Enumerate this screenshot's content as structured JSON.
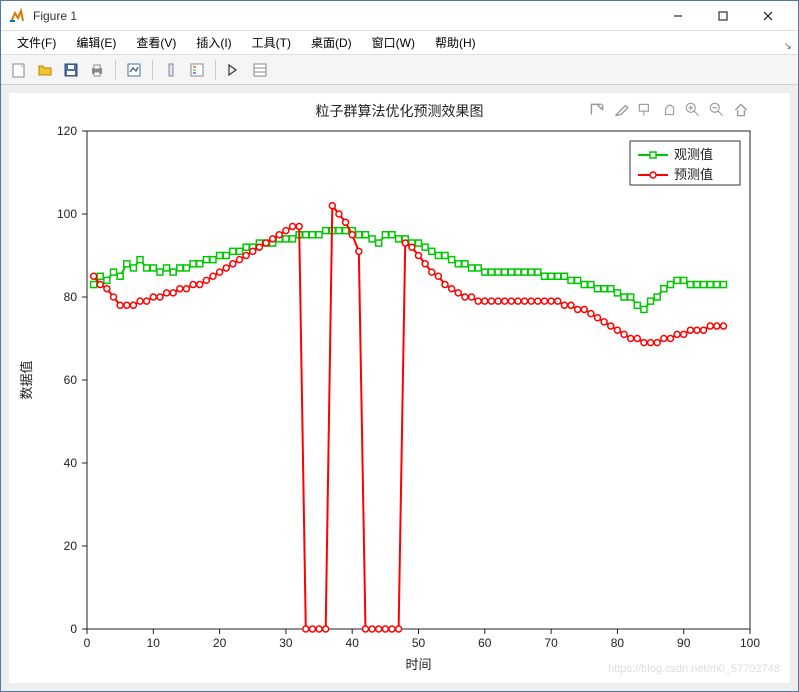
{
  "window": {
    "title": "Figure 1"
  },
  "menu": {
    "file": "文件(F)",
    "edit": "编辑(E)",
    "view": "查看(V)",
    "insert": "插入(I)",
    "tools": "工具(T)",
    "desktop": "桌面(D)",
    "window": "窗口(W)",
    "help": "帮助(H)"
  },
  "chart_data": {
    "type": "line",
    "title": "粒子群算法优化预测效果图",
    "xlabel": "时间",
    "ylabel": "数据值",
    "xlim": [
      0,
      100
    ],
    "ylim": [
      0,
      120
    ],
    "xticks": [
      0,
      10,
      20,
      30,
      40,
      50,
      60,
      70,
      80,
      90,
      100
    ],
    "yticks": [
      0,
      20,
      40,
      60,
      80,
      100,
      120
    ],
    "series": [
      {
        "name": "观测值",
        "color": "#00c800",
        "marker": "square",
        "x": [
          1,
          2,
          3,
          4,
          5,
          6,
          7,
          8,
          9,
          10,
          11,
          12,
          13,
          14,
          15,
          16,
          17,
          18,
          19,
          20,
          21,
          22,
          23,
          24,
          25,
          26,
          27,
          28,
          29,
          30,
          31,
          32,
          33,
          34,
          35,
          36,
          37,
          38,
          39,
          40,
          41,
          42,
          43,
          44,
          45,
          46,
          47,
          48,
          49,
          50,
          51,
          52,
          53,
          54,
          55,
          56,
          57,
          58,
          59,
          60,
          61,
          62,
          63,
          64,
          65,
          66,
          67,
          68,
          69,
          70,
          71,
          72,
          73,
          74,
          75,
          76,
          77,
          78,
          79,
          80,
          81,
          82,
          83,
          84,
          85,
          86,
          87,
          88,
          89,
          90,
          91,
          92,
          93,
          94,
          95,
          96
        ],
        "values": [
          83,
          85,
          84,
          86,
          85,
          88,
          87,
          89,
          87,
          87,
          86,
          87,
          86,
          87,
          87,
          88,
          88,
          89,
          89,
          90,
          90,
          91,
          91,
          92,
          92,
          93,
          93,
          93,
          94,
          94,
          94,
          95,
          95,
          95,
          95,
          96,
          96,
          96,
          96,
          96,
          95,
          95,
          94,
          93,
          95,
          95,
          94,
          94,
          93,
          93,
          92,
          91,
          90,
          90,
          89,
          88,
          88,
          87,
          87,
          86,
          86,
          86,
          86,
          86,
          86,
          86,
          86,
          86,
          85,
          85,
          85,
          85,
          84,
          84,
          83,
          83,
          82,
          82,
          82,
          81,
          80,
          80,
          78,
          77,
          79,
          80,
          82,
          83,
          84,
          84,
          83,
          83,
          83,
          83,
          83,
          83
        ]
      },
      {
        "name": "预测值",
        "color": "#ff0000",
        "marker": "circle",
        "x": [
          1,
          2,
          3,
          4,
          5,
          6,
          7,
          8,
          9,
          10,
          11,
          12,
          13,
          14,
          15,
          16,
          17,
          18,
          19,
          20,
          21,
          22,
          23,
          24,
          25,
          26,
          27,
          28,
          29,
          30,
          31,
          32,
          33,
          34,
          35,
          36,
          37,
          38,
          39,
          40,
          41,
          42,
          43,
          44,
          45,
          46,
          47,
          48,
          49,
          50,
          51,
          52,
          53,
          54,
          55,
          56,
          57,
          58,
          59,
          60,
          61,
          62,
          63,
          64,
          65,
          66,
          67,
          68,
          69,
          70,
          71,
          72,
          73,
          74,
          75,
          76,
          77,
          78,
          79,
          80,
          81,
          82,
          83,
          84,
          85,
          86,
          87,
          88,
          89,
          90,
          91,
          92,
          93,
          94,
          95,
          96
        ],
        "values": [
          85,
          83,
          82,
          80,
          78,
          78,
          78,
          79,
          79,
          80,
          80,
          81,
          81,
          82,
          82,
          83,
          83,
          84,
          85,
          86,
          87,
          88,
          89,
          90,
          91,
          92,
          93,
          94,
          95,
          96,
          97,
          97,
          0,
          0,
          0,
          0,
          102,
          100,
          98,
          95,
          91,
          0,
          0,
          0,
          0,
          0,
          0,
          93,
          92,
          90,
          88,
          86,
          85,
          83,
          82,
          81,
          80,
          80,
          79,
          79,
          79,
          79,
          79,
          79,
          79,
          79,
          79,
          79,
          79,
          79,
          79,
          78,
          78,
          77,
          77,
          76,
          75,
          74,
          73,
          72,
          71,
          70,
          70,
          69,
          69,
          69,
          70,
          70,
          71,
          71,
          72,
          72,
          72,
          73,
          73,
          73
        ]
      }
    ],
    "legend": {
      "entries": [
        "观测值",
        "预测值"
      ]
    }
  },
  "watermark": "https://blog.csdn.net/m0_57702748"
}
